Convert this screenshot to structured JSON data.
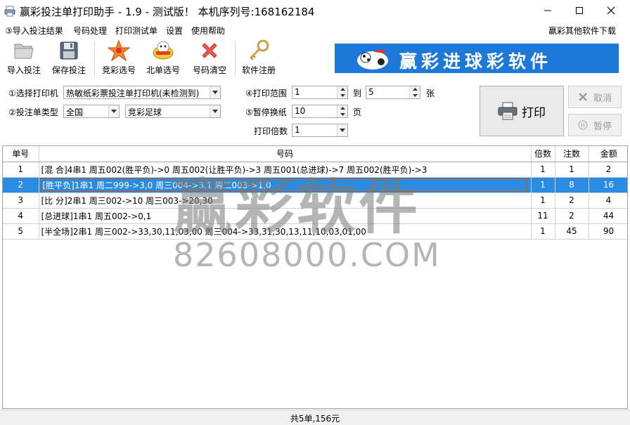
{
  "window": {
    "title": "赢彩投注单打印助手 - 1.9 - 测试版！  本机序列号:168162184"
  },
  "menu": {
    "items": [
      "③导入投注结果",
      "号码处理",
      "打印测试单",
      "设置",
      "使用帮助"
    ],
    "right_link": "赢彩其他软件下载"
  },
  "toolbar": {
    "buttons": [
      {
        "label": "导入投注",
        "icon": "folder-open-icon"
      },
      {
        "label": "保存投注",
        "icon": "floppy-disk-icon"
      },
      {
        "label": "竞彩选号",
        "icon": "star-burst-icon"
      },
      {
        "label": "北单选号",
        "icon": "bingo-ball-icon"
      },
      {
        "label": "号码清空",
        "icon": "red-x-icon"
      },
      {
        "label": "软件注册",
        "icon": "key-icon"
      }
    ]
  },
  "banner": {
    "text": "赢彩进球彩软件",
    "color": "#1e78d8"
  },
  "settings": {
    "printer_label": "①选择打印机",
    "printer_value": "热敏纸彩票投注单打印机(未检测到)",
    "type_label": "②投注单类型",
    "type_region": "全国",
    "type_game": "竞彩足球",
    "range_label": "④打印范围",
    "range_from": "1",
    "range_to_label": "到",
    "range_to": "5",
    "range_unit": "张",
    "pause_label": "⑤暂停换纸",
    "pause_value": "10",
    "pause_unit": "页",
    "copies_label": "打印倍数",
    "copies_value": "1",
    "print_button": "打印",
    "cancel_button": "取消",
    "pause_button": "暂停"
  },
  "grid": {
    "headers": [
      "单号",
      "号码",
      "倍数",
      "注数",
      "金额"
    ],
    "rows": [
      {
        "id": "1",
        "code": "[混   合]4串1 周五002(胜平负)->0 周五002(让胜平负)->3 周五001(总进球)->7 周五002(胜平负)->3",
        "times": "1",
        "bets": "1",
        "amount": "2"
      },
      {
        "id": "2",
        "code": "[胜平负]1串1 周二999->3,0 周三004->3,1 周二003->1,0",
        "times": "1",
        "bets": "8",
        "amount": "16",
        "selected": true
      },
      {
        "id": "3",
        "code": "[比   分]2串1 周三002->10 周三003->20,30",
        "times": "1",
        "bets": "2",
        "amount": "4"
      },
      {
        "id": "4",
        "code": "[总进球]1串1 周五002->0,1",
        "times": "11",
        "bets": "2",
        "amount": "44"
      },
      {
        "id": "5",
        "code": "[半全场]2串1 周三002->33,30,11,03,00 周三004->33,31,30,13,11,10,03,01,00",
        "times": "1",
        "bets": "45",
        "amount": "90"
      }
    ]
  },
  "watermark": {
    "line1": "赢彩软件",
    "line2": "82608000.COM"
  },
  "status": {
    "text": "共5单,156元"
  },
  "colors": {
    "selection": "#2a8ce0",
    "accent": "#1e78d8"
  }
}
